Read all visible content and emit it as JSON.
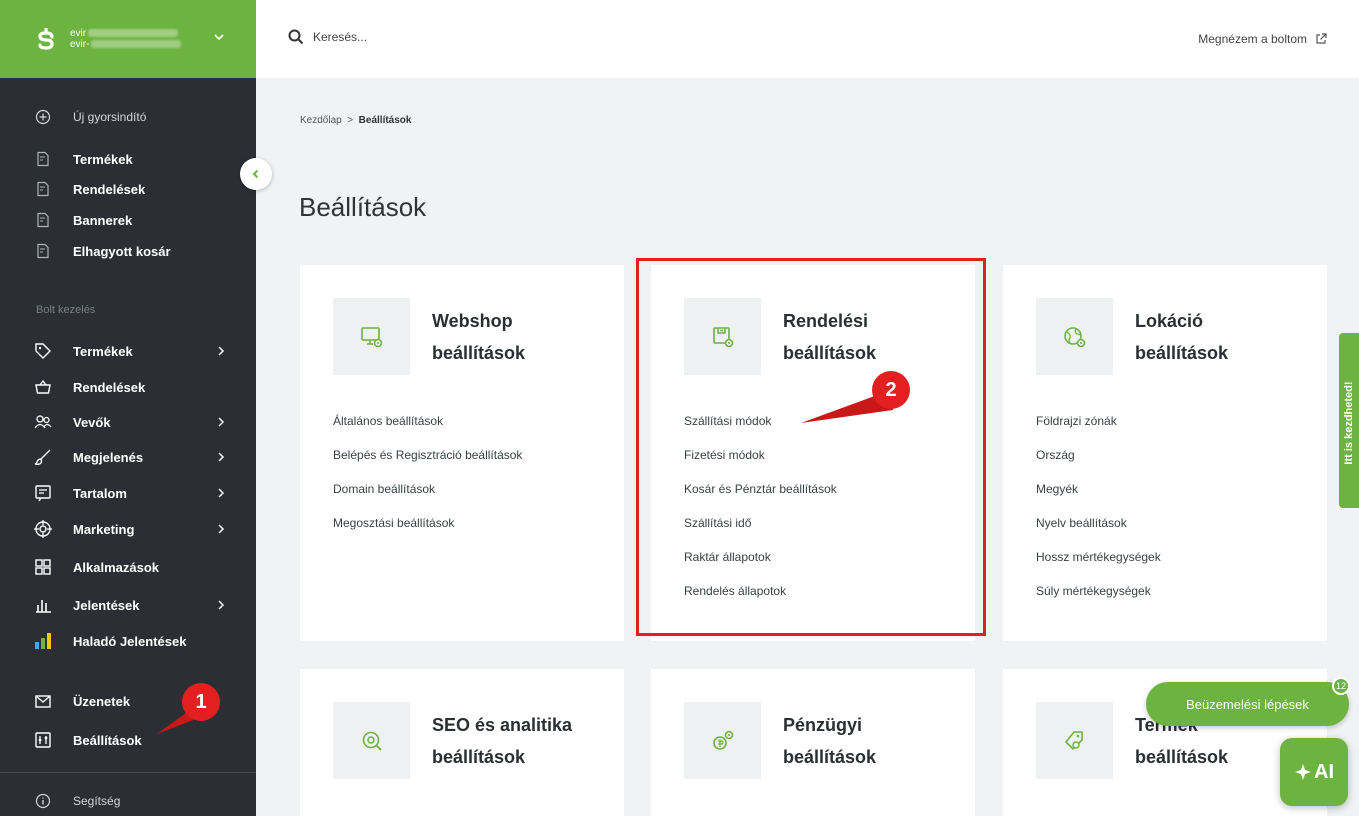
{
  "brand": {
    "shop_name": "evir",
    "shop_sub": "evir-",
    "color": "#6db33f"
  },
  "sidebar": {
    "quick": [
      {
        "label": "Új gyorsindító",
        "icon": "plus-circle-icon"
      },
      {
        "label": "Termékek",
        "icon": "doc-star-icon"
      },
      {
        "label": "Rendelések",
        "icon": "doc-star-icon"
      },
      {
        "label": "Bannerek",
        "icon": "doc-star-icon"
      },
      {
        "label": "Elhagyott kosár",
        "icon": "doc-star-icon"
      }
    ],
    "section_label": "Bolt kezelés",
    "items": [
      {
        "label": "Termékek",
        "icon": "tag-icon"
      },
      {
        "label": "Rendelések",
        "icon": "basket-icon"
      },
      {
        "label": "Vevők",
        "icon": "users-icon"
      },
      {
        "label": "Megjelenés",
        "icon": "brush-icon"
      },
      {
        "label": "Tartalom",
        "icon": "content-icon"
      },
      {
        "label": "Marketing",
        "icon": "target-icon"
      },
      {
        "label": "Alkalmazások",
        "icon": "apps-icon"
      },
      {
        "label": "Jelentések",
        "icon": "bars-icon"
      },
      {
        "label": "Haladó Jelentések",
        "icon": "advanced-report-icon"
      }
    ],
    "bottom": [
      {
        "label": "Üzenetek",
        "icon": "mail-icon"
      },
      {
        "label": "Beállítások",
        "icon": "settings-icon"
      }
    ],
    "help": {
      "label": "Segítség",
      "icon": "info-icon"
    }
  },
  "topbar": {
    "search_placeholder": "Keresés...",
    "view_store": "Megnézem a boltom"
  },
  "breadcrumb": {
    "home": "Kezdőlap",
    "separator": ">",
    "current": "Beállítások"
  },
  "page_title": "Beállítások",
  "cards": [
    {
      "title1": "Webshop",
      "title2": "beállítások",
      "icon": "monitor-gear-icon",
      "links": [
        "Általános beállítások",
        "Belépés és Regisztráció beállítások",
        "Domain beállítások",
        "Megosztási beállítások"
      ]
    },
    {
      "title1": "Rendelési",
      "title2": "beállítások",
      "icon": "order-gear-icon",
      "links": [
        "Szállítási módok",
        "Fizetési módok",
        "Kosár és Pénztár beállítások",
        "Szállítási idő",
        "Raktár állapotok",
        "Rendelés állapotok"
      ]
    },
    {
      "title1": "Lokáció",
      "title2": "beállítások",
      "icon": "globe-gear-icon",
      "links": [
        "Földrajzi zónák",
        "Ország",
        "Megyék",
        "Nyelv beállítások",
        "Hossz mértékegységek",
        "Súly mértékegységek"
      ]
    },
    {
      "title1": "SEO és analitika",
      "title2": "beállítások",
      "icon": "search-gear-icon",
      "links": []
    },
    {
      "title1": "Pénzügyi",
      "title2": "beállítások",
      "icon": "money-gear-icon",
      "links": []
    },
    {
      "title1": "Termék",
      "title2": "beállítások",
      "icon": "tag-gear-icon",
      "links": []
    }
  ],
  "markers": {
    "one": "1",
    "two": "2",
    "color": "#e32020"
  },
  "widgets": {
    "side_tab": "Itt is kezdheted!",
    "onboarding": "Beüzemelési lépések",
    "onboarding_count": "12",
    "ai": "AI"
  }
}
